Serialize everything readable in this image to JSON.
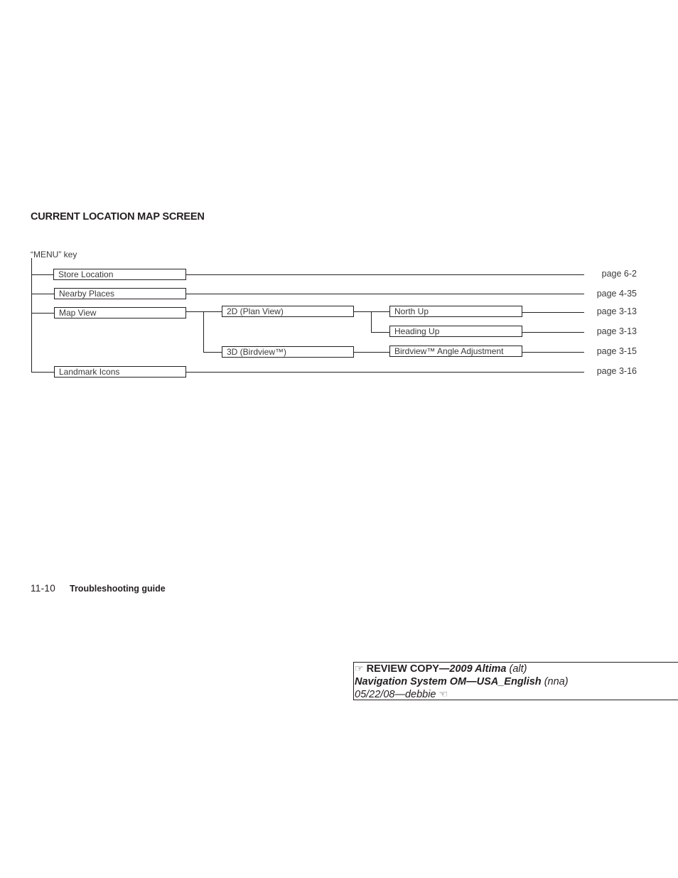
{
  "section": {
    "title": "CURRENT LOCATION MAP SCREEN"
  },
  "menu_tree": {
    "root": "“MENU” key",
    "items": [
      {
        "label": "Store Location",
        "page": "page 6-2"
      },
      {
        "label": "Nearby Places",
        "page": "page 4-35"
      },
      {
        "label": "Map View",
        "children": [
          {
            "label": "2D (Plan View)",
            "children": [
              {
                "label": "North Up",
                "page": "page 3-13"
              },
              {
                "label": "Heading Up",
                "page": "page 3-13"
              }
            ]
          },
          {
            "label": "3D (Birdview™)",
            "children": [
              {
                "label": "Birdview™ Angle Adjustment",
                "page": "page 3-15"
              }
            ]
          }
        ]
      },
      {
        "label": "Landmark Icons",
        "page": "page 3-16"
      }
    ]
  },
  "footer": {
    "page_number": "11-10",
    "chapter": "Troubleshooting guide"
  },
  "review_stamp": {
    "icon_left": "pointing-hand-right-icon",
    "line1_bold": "REVIEW COPY—",
    "line1_bold_italic": "2009 Altima",
    "line1_italic": " (alt)",
    "line2_bold_italic": "Navigation System OM—USA_English",
    "line2_italic": " (nna)",
    "line3_italic": "05/22/08—debbie",
    "icon_right": "pointing-hand-left-icon"
  }
}
